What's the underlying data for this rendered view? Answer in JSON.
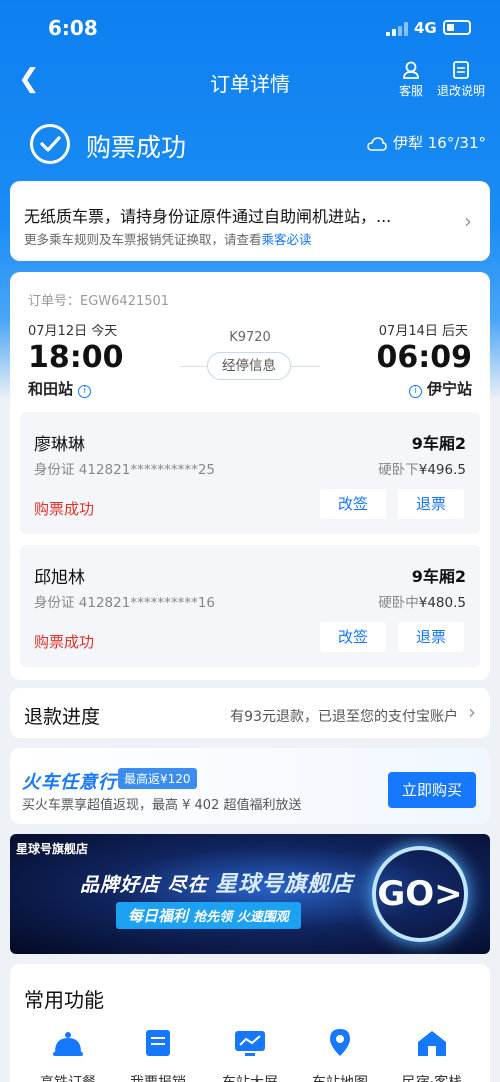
{
  "status": {
    "time": "6:08",
    "network": "4G"
  },
  "nav": {
    "title": "订单详情",
    "service": "客服",
    "refund_info": "退改说明"
  },
  "success": {
    "text": "购票成功"
  },
  "weather": {
    "text": "伊犁 16°/31°"
  },
  "notice": {
    "line1": "无纸质车票，请持身份证原件通过自助闸机进站，...",
    "line2": "更多乘车规则及车票报销凭证换取，请查看",
    "link": "乘客必读"
  },
  "order": {
    "number": "订单号：EGW6421501",
    "depart": {
      "date": "07月12日 今天",
      "time": "18:00",
      "station": "和田站"
    },
    "arrive": {
      "date": "07月14日 后天",
      "time": "06:09",
      "station": "伊宁站"
    },
    "train": "K9720",
    "stops_button": "经停信息",
    "passengers": [
      {
        "name": "廖琳琳",
        "car": "9车厢2",
        "id": "身份证 412821**********25",
        "seat": "硬卧下",
        "price": "¥496.5",
        "status": "购票成功",
        "change": "改签",
        "refund": "退票"
      },
      {
        "name": "邱旭林",
        "car": "9车厢2",
        "id": "身份证 412821**********16",
        "seat": "硬卧中",
        "price": "¥480.5",
        "status": "购票成功",
        "change": "改签",
        "refund": "退票"
      }
    ]
  },
  "refund": {
    "title": "退款进度",
    "detail": "有93元退款，已退至您的支付宝账户"
  },
  "promo": {
    "title": "火车任意行",
    "tag": "最高返¥120",
    "subtitle": "买火车票享超值返现，最高 ¥ 402 超值福利放送",
    "button": "立即购买"
  },
  "banner": {
    "shop": "星球号旗舰店",
    "headline_a": "品牌好店 尽在",
    "headline_b": "星球号旗舰店",
    "sub_a": "每日福利",
    "sub_b": "抢先领 火速围观",
    "go": "GO>"
  },
  "functions": {
    "title": "常用功能",
    "items": [
      "高铁订餐",
      "我要报销",
      "车站大屏",
      "车站地图",
      "民宿·客栈"
    ]
  }
}
